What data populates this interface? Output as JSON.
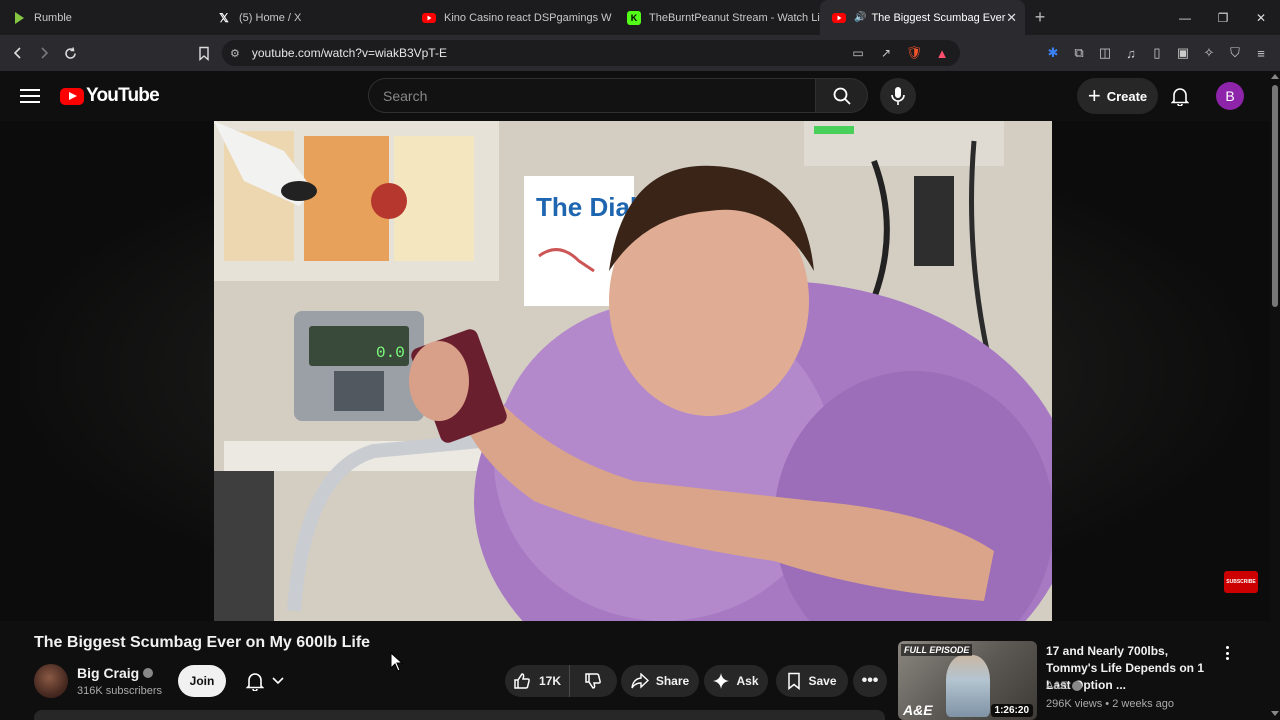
{
  "browser": {
    "tabs": [
      {
        "title": "Rumble",
        "icon": "rumble-icon",
        "color": "#85c742"
      },
      {
        "title": "(5) Home / X",
        "icon": "x-icon",
        "color": "#ffffff"
      },
      {
        "title": "Kino Casino react DSPgamings W",
        "icon": "youtube-icon",
        "color": "#ff0000"
      },
      {
        "title": "TheBurntPeanut Stream - Watch Live",
        "icon": "kick-icon",
        "color": "#53fc18"
      },
      {
        "title": "The Biggest Scumbag Ever on",
        "icon": "youtube-icon",
        "color": "#ff0000",
        "active": true
      }
    ],
    "url": "youtube.com/watch?v=wiakB3VpT-E"
  },
  "masthead": {
    "logo_text": "YouTube",
    "search_placeholder": "Search",
    "create_label": "Create",
    "avatar_letter": "B"
  },
  "player": {
    "badge": "SUBSCRIBE"
  },
  "video": {
    "title": "The Biggest Scumbag Ever on My 600lb Life",
    "channel_name": "Big Craig",
    "subscribers": "316K subscribers",
    "join_label": "Join",
    "likes": "17K",
    "share_label": "Share",
    "ask_label": "Ask",
    "save_label": "Save"
  },
  "recommendation": {
    "title": "17 and Nearly 700lbs, Tommy's Life Depends on 1 Last Option ...",
    "channel": "A&E",
    "views": "296K views",
    "age": "2 weeks ago",
    "meta": "296K views • 2 weeks ago",
    "duration": "1:26:20",
    "thumb_badge": "FULL EPISODE",
    "thumb_logo": "A&E"
  },
  "colors": {
    "brand_red": "#ff0000",
    "background": "#0f0f0f",
    "avatar_purple": "#8e24aa"
  }
}
